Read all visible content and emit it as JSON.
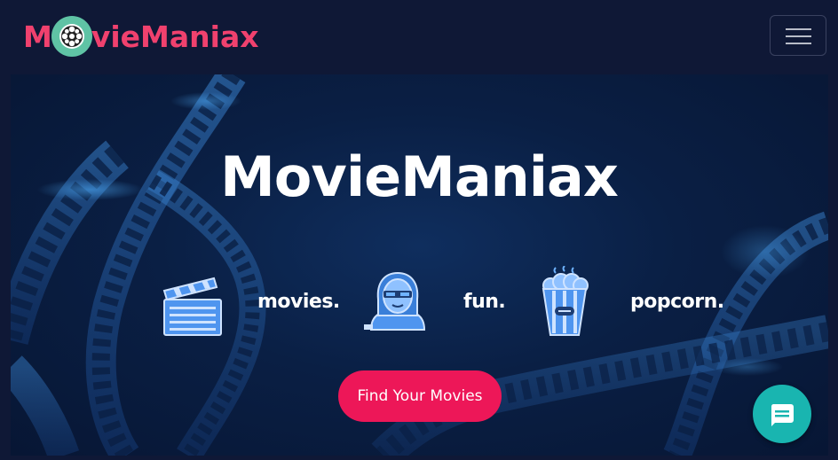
{
  "brand": {
    "prefix": "M",
    "suffix": "vieManiax",
    "logo_icon": "film-reel-icon"
  },
  "navbar": {
    "toggle_icon": "hamburger-menu-icon"
  },
  "hero": {
    "title": "MovieManiax",
    "features": [
      {
        "label": "movies.",
        "icon": "clapperboard-icon"
      },
      {
        "label": "fun.",
        "icon": "viewer-3d-glasses-icon"
      },
      {
        "label": "popcorn.",
        "icon": "popcorn-icon"
      }
    ],
    "cta_label": "Find Your Movies"
  },
  "chat": {
    "icon": "chat-bubble-icon"
  },
  "colors": {
    "accent": "#ed1758",
    "brand_text": "#f0416e",
    "reel": "#5fc3a5",
    "chat": "#19b5b0",
    "background": "#0f1836"
  }
}
